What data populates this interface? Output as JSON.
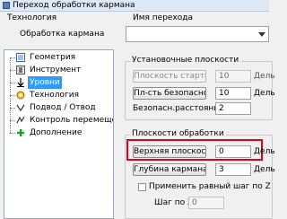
{
  "window": {
    "title": "Переход обработки кармана"
  },
  "technology": {
    "label": "Технология",
    "value": "Обработка кармана"
  },
  "transition_name": {
    "label": "Имя перехода",
    "value": ""
  },
  "tree": {
    "items": [
      {
        "label": "Геометрия",
        "icon": "geometry-icon",
        "selected": false
      },
      {
        "label": "Инструмент",
        "icon": "tool-icon",
        "selected": false
      },
      {
        "label": "Уровни",
        "icon": "levels-icon",
        "selected": true
      },
      {
        "label": "Технология",
        "icon": "technology-icon",
        "selected": false
      },
      {
        "label": "Подвод / Отвод",
        "icon": "approach-retract-icon",
        "selected": false
      },
      {
        "label": "Контроль перемещен",
        "icon": "motion-control-icon",
        "selected": false
      },
      {
        "label": "Дополнение",
        "icon": "plus-icon",
        "selected": false
      }
    ]
  },
  "setup_planes": {
    "title": "Установочные плоскости",
    "start_plane": {
      "button": "Плоскость старта",
      "value": "10",
      "suffix": "Дель"
    },
    "safe_plane": {
      "button": "Пл-сть безопасности",
      "value": "10",
      "suffix": "Дель"
    },
    "safe_distance": {
      "label": "Безопасн.расстояние:",
      "value": "2"
    }
  },
  "machining_planes": {
    "title": "Плоскости обработки",
    "top_plane": {
      "button": "Верхняя плоскость",
      "value": "0",
      "suffix": "Дель"
    },
    "pocket_depth": {
      "button": "Глубина кармана",
      "value": "3",
      "suffix": "Дель"
    },
    "equal_step": {
      "label": "Применить равный шаг по Z",
      "checked": false
    },
    "z_step": {
      "label": "Шаг по Z:",
      "value": "0"
    }
  },
  "colors": {
    "selection": "#3399ff",
    "highlight": "#e0001b"
  }
}
